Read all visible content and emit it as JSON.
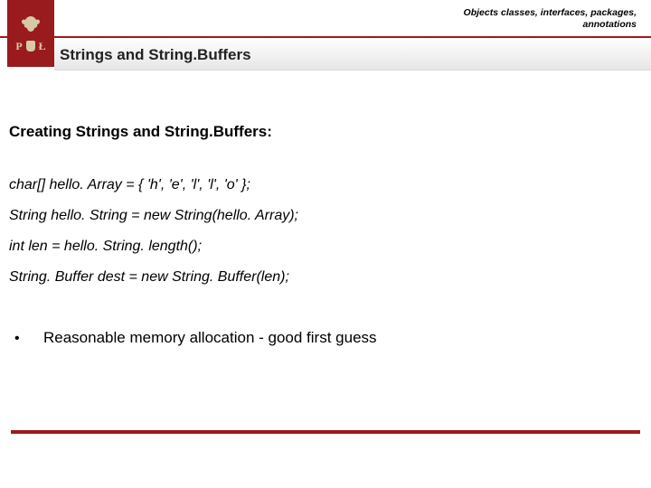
{
  "header": {
    "top_label_line1": "Objects classes, interfaces, packages,",
    "top_label_line2": "annotations",
    "logo_letter_left": "P",
    "logo_letter_right": "Ł",
    "title": "Strings and String.Buffers"
  },
  "content": {
    "section_heading": "Creating Strings and String.Buffers:",
    "code_lines": [
      "char[] hello. Array = { 'h', 'e', 'l', 'l', 'o' };",
      "String hello. String = new String(hello. Array);",
      "int len = hello. String. length();",
      "String. Buffer dest = new String. Buffer(len);"
    ],
    "bullet": {
      "mark": "•",
      "text": "Reasonable memory allocation - good first guess"
    }
  }
}
